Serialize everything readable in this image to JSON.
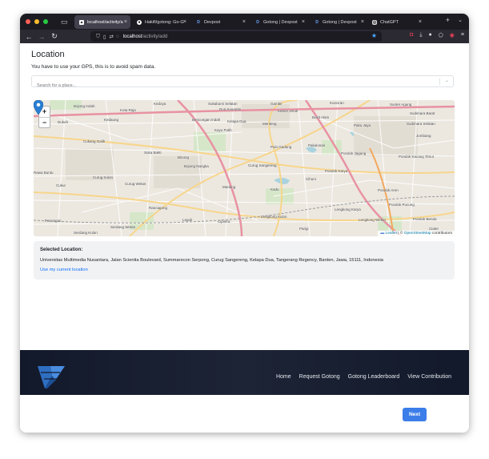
{
  "browser": {
    "tabs": [
      {
        "label": "localhost/activity/a",
        "favicon": "page-icon",
        "active": true
      },
      {
        "label": "Hakifi/gotong: Go-G",
        "favicon": "github-icon",
        "active": false
      },
      {
        "label": "Devpost",
        "favicon": "devpost-icon",
        "active": false
      },
      {
        "label": "Gotong | Devpost",
        "favicon": "devpost-icon",
        "active": false
      },
      {
        "label": "Gotong | Devpost",
        "favicon": "devpost-icon",
        "active": false
      },
      {
        "label": "ChatGPT",
        "favicon": "chatgpt-icon",
        "active": false
      }
    ],
    "url_host": "localhost",
    "url_path": "/activity/add",
    "new_tab": "+",
    "tab_list": "⌄"
  },
  "page": {
    "title": "Location",
    "subtitle": "You have to use your GPS, this is to avoid spam data.",
    "search_placeholder": "Search for a place..."
  },
  "map": {
    "zoom_in": "+",
    "zoom_out": "−",
    "attribution_leaflet": "Leaflet",
    "attribution_sep": " | © ",
    "attribution_osm": "OpenStreetMap",
    "attribution_tail": " contributors",
    "labels": {
      "bojong_indah": "Bojong Indah",
      "kedoya": "Kedoya",
      "sukabumi_selatan": "Sukabumi Selatan",
      "gambir": "Gambir",
      "sunter_agung": "Sunter Agung",
      "kunciran": "Kunciran",
      "kota_raja": "Kota Raja",
      "duri_kosambi": "Duri Kosambi",
      "kebon_jeruk": "Kebon Jeruk",
      "kelapa_dua": "Kelapa Dua",
      "menteng": "Menteng",
      "kayu_putih": "Kayu Putih",
      "pulo_gadung": "Pulo Gadung",
      "sudimara_barat": "Sudimara Barat",
      "dukuh": "Dukuh",
      "kedaung": "Kedaung",
      "bencongan_indah": "Bencongan Indah",
      "pakulonan": "Pakulonan",
      "bukit_alam": "Bukit Alam",
      "paku_jaya": "Paku Jaya",
      "sudimara_selatan": "Sudimara Selatan",
      "cukang_galih": "Cukang Galih",
      "bojong_nangka": "Bojong Nangka",
      "jombang": "Jombang",
      "pondok_kacang_timur": "Pondok Kacang Timur",
      "sukabakti": "Suka Bakti",
      "binong": "Binong",
      "curug_sangereng": "Curug Sangereng",
      "pondok_jagung": "Pondok Jagung",
      "curug_kulon": "Curug Kulon",
      "medang": "Medang",
      "rawa_buntu": "Rawa Buntu",
      "pondok_karya": "Pondok Karya",
      "cukur": "Cukur",
      "curug_wetan": "Curug Wetan",
      "kadu": "Kadu",
      "cihuni": "Cihuni",
      "pondok_aren": "Pondok Aren",
      "lengkong_karya": "Lengkong Karya",
      "rancagong": "Rancagong",
      "legok": "Legok",
      "cijantra": "Cijantra",
      "lengkong_kulon": "Lengkong Kulon",
      "lengkong_wetan": "Lengkong Wetan",
      "pondok_pucung": "Pondok Pucung",
      "serdang_kulon": "Serdang Kulon",
      "serdang_wetan": "Serdang Wetan",
      "parigi": "Parigi",
      "panongan": "Panongan",
      "ciater": "Ciater",
      "pondok_benda": "Pondok Benda"
    }
  },
  "selected_location": {
    "title": "Selected Location:",
    "address": "Universitas Multimedia Nusantara, Jalan Scientia Boulevard, Summarecon Serpong, Curug Sangereng, Kelapa Dua, Tangerang Regency, Banten, Jawa, 15111, Indonesia",
    "use_current": "Use my current location"
  },
  "footer": {
    "nav": [
      "Home",
      "Request Gotong",
      "Gotong Leaderboard",
      "View Contribution"
    ]
  },
  "actions": {
    "next": "Next"
  },
  "colors": {
    "primary": "#3b7de9",
    "footer_bg": "#161d2f",
    "marker": "#2a7fd4",
    "link": "#0d6efd"
  }
}
